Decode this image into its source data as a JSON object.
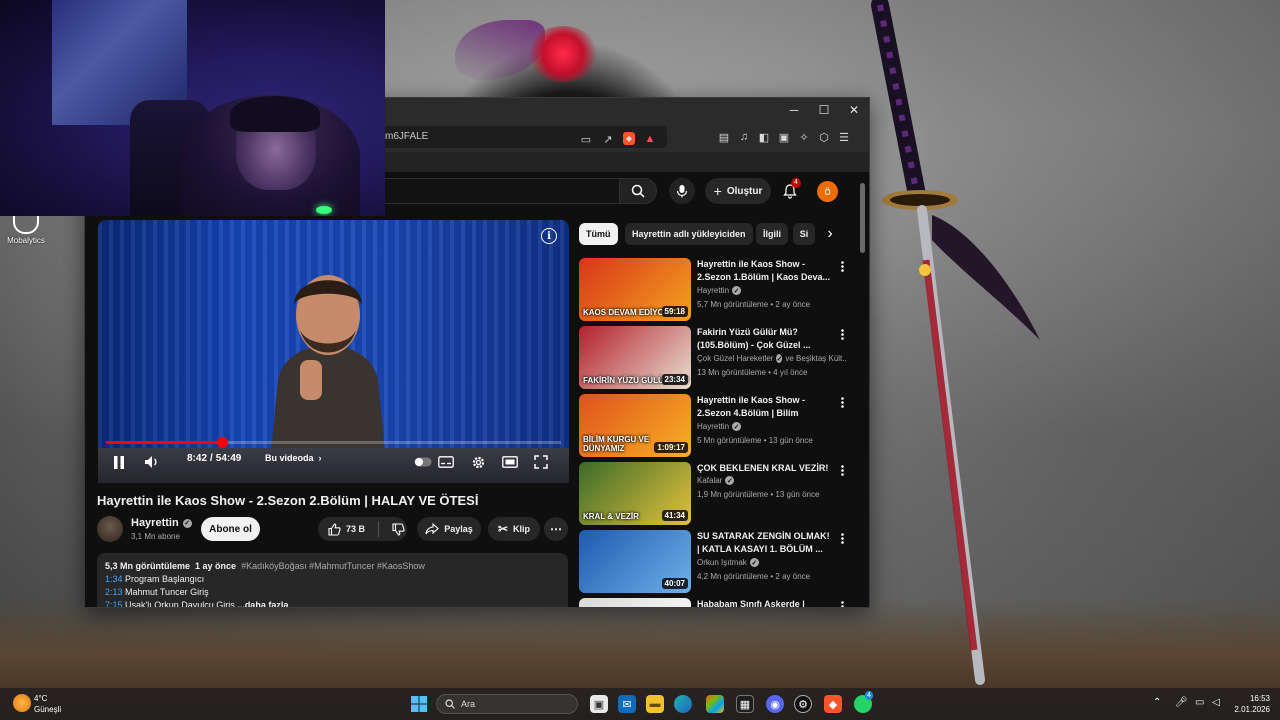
{
  "desktop": {
    "icon_label": "Mobalytics"
  },
  "browser": {
    "url_fragment": "m6JFALE",
    "controls": {
      "minimize": "─",
      "maximize": "☐",
      "close": "✕"
    }
  },
  "youtube": {
    "create_label": "Oluştur",
    "notification_count": "4",
    "avatar_letter": "ö",
    "player": {
      "time_current": "8:42",
      "time_separator": "/",
      "time_total": "54:49",
      "chapter_label": "Bu videoda",
      "progress_fraction": 0.159
    },
    "video": {
      "title": "Hayrettin ile Kaos Show - 2.Sezon 2.Bölüm | HALAY VE ÖTESİ",
      "channel": "Hayrettin",
      "subscribers": "3,1 Mn abone",
      "subscribe_label": "Abone ol",
      "likes": "73 B",
      "share_label": "Paylaş",
      "clip_label": "Klip"
    },
    "description": {
      "views": "5,3 Mn görüntüleme",
      "age": "1 ay önce",
      "tags": "#KadıköyBoğası #MahmutTuncer #KaosShow",
      "chapters": [
        {
          "time": "1:34",
          "label": "Program Başlangıcı"
        },
        {
          "time": "2:13",
          "label": "Mahmut Tuncer Giriş"
        },
        {
          "time": "7:15",
          "label": "Uşak'lı Orkun Davulcu Giriş"
        }
      ],
      "more_label": "...daha fazla"
    },
    "chips": [
      "Tümü",
      "Hayrettin adlı yükleyiciden",
      "İlgili",
      "Si"
    ],
    "recommendations": [
      {
        "title": "Hayrettin ile Kaos Show - 2.Sezon 1.Bölüm | Kaos Deva...",
        "channel": "Hayrettin",
        "meta": "5,7 Mn görüntüleme • 2 ay önce",
        "duration": "59:18",
        "caption": "KAOS DEVAM EDİYOR!",
        "colors": [
          "#d8361a",
          "#f4a21f"
        ]
      },
      {
        "title": "Fakirin Yüzü Gülür Mü? (105.Bölüm) - Çok Güzel ...",
        "channel": "Çok Güzel Hareketler",
        "channel_extra": "ve Beşiktaş Kült...",
        "meta": "13 Mn görüntüleme • 4 yıl önce",
        "duration": "23:34",
        "caption": "FAKİRİN YÜZÜ GÜLÜR MÜ?",
        "colors": [
          "#b3202d",
          "#e8e0d0"
        ]
      },
      {
        "title": "Hayrettin ile Kaos Show - 2.Sezon 4.Bölüm | Bilim Kurgu...",
        "channel": "Hayrettin",
        "meta": "5 Mn görüntüleme • 13 gün önce",
        "duration": "1:09:17",
        "caption": "BİLİM KURGU VE DÜNYAMIZ",
        "colors": [
          "#e0521c",
          "#f7b024"
        ]
      },
      {
        "title": "ÇOK BEKLENEN KRAL VEZİR!",
        "channel": "Kafalar",
        "meta": "1,9 Mn görüntüleme • 13 gün önce",
        "duration": "41:34",
        "caption": "KRAL & VEZİR",
        "colors": [
          "#3b6b2a",
          "#e3c13a"
        ]
      },
      {
        "title": "SU SATARAK ZENGİN OLMAK! | KATLA KASAYI 1. BÖLÜM ...",
        "channel": "Orkun Işıtmak",
        "meta": "4,2 Mn görüntüleme • 2 ay önce",
        "duration": "40:07",
        "caption": "",
        "colors": [
          "#1e5ab0",
          "#6fb0e8"
        ]
      },
      {
        "title": "Hababam Sınıfı Askerde | Şafak...",
        "channel": "",
        "meta": "",
        "duration": "",
        "caption": "",
        "colors": [
          "#d9d9d9",
          "#ffffff"
        ]
      }
    ]
  },
  "taskbar": {
    "temperature": "4°C",
    "weather_condition": "Güneşli",
    "search_placeholder": "Ara",
    "time": "16:53",
    "date": "2.01.2026",
    "whatsapp_badge": "4"
  }
}
